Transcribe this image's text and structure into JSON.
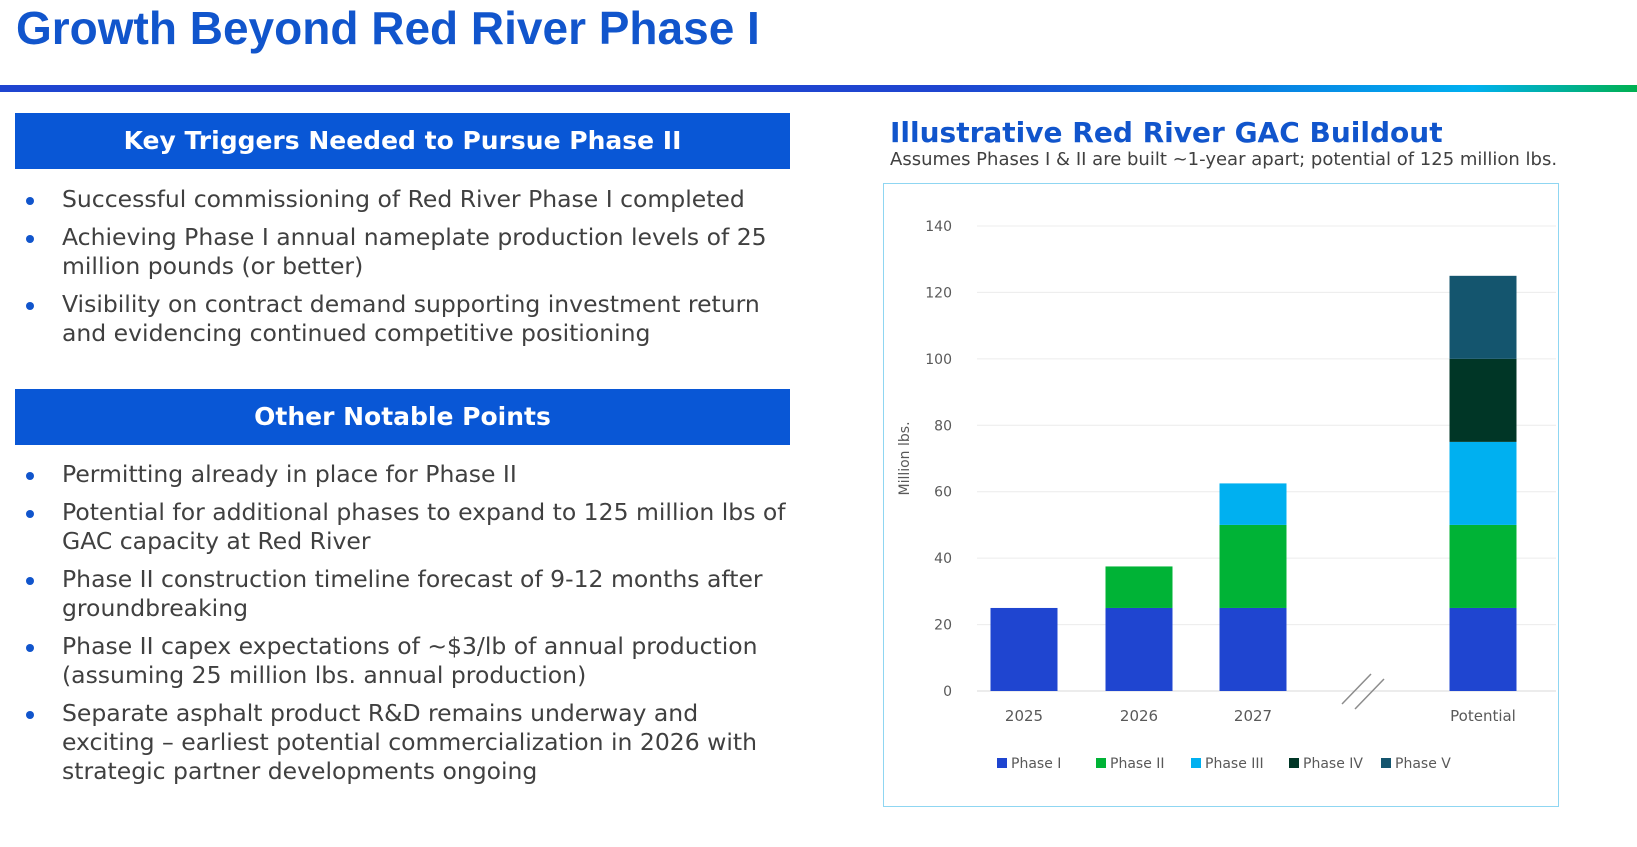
{
  "title": "Growth Beyond Red River Phase I",
  "sections": [
    {
      "header": "Key Triggers Needed to Pursue Phase II",
      "bullets": [
        "Successful commissioning of Red River Phase I completed",
        "Achieving Phase I annual nameplate production levels of 25 million pounds (or better)",
        "Visibility on contract demand supporting investment return and evidencing continued competitive positioning"
      ]
    },
    {
      "header": "Other Notable Points",
      "bullets": [
        "Permitting already in place for Phase II",
        "Potential for additional phases to expand to 125 million lbs of GAC capacity at Red River",
        "Phase II construction timeline forecast of 9-12 months after groundbreaking",
        "Phase II capex expectations of ~$3/lb of annual production (assuming 25 million lbs. annual production)",
        "Separate asphalt product R&D remains underway and exciting – earliest potential commercialization in 2026 with strategic partner developments ongoing"
      ]
    }
  ],
  "chart_data": {
    "type": "bar",
    "stacked": true,
    "title": "Illustrative Red River GAC Buildout",
    "subtitle": "Assumes Phases I & II are built ~1-year apart; potential of 125 million lbs.",
    "ylabel": "Million lbs.",
    "ylim": [
      0,
      140
    ],
    "yticks": [
      0,
      20,
      40,
      60,
      80,
      100,
      120,
      140
    ],
    "categories": [
      "2025",
      "2026",
      "2027",
      "Potential"
    ],
    "axis_break_after": "2027",
    "legend_position": "bottom",
    "series": [
      {
        "name": "Phase I",
        "color": "#1f45d0",
        "values": [
          25,
          25,
          25,
          25
        ]
      },
      {
        "name": "Phase II",
        "color": "#00b336",
        "values": [
          0,
          12.5,
          25,
          25
        ]
      },
      {
        "name": "Phase III",
        "color": "#00b0f0",
        "values": [
          0,
          0,
          12.5,
          25
        ]
      },
      {
        "name": "Phase IV",
        "color": "#003626",
        "values": [
          0,
          0,
          0,
          25
        ]
      },
      {
        "name": "Phase V",
        "color": "#14556e",
        "values": [
          0,
          0,
          0,
          25
        ]
      }
    ]
  }
}
